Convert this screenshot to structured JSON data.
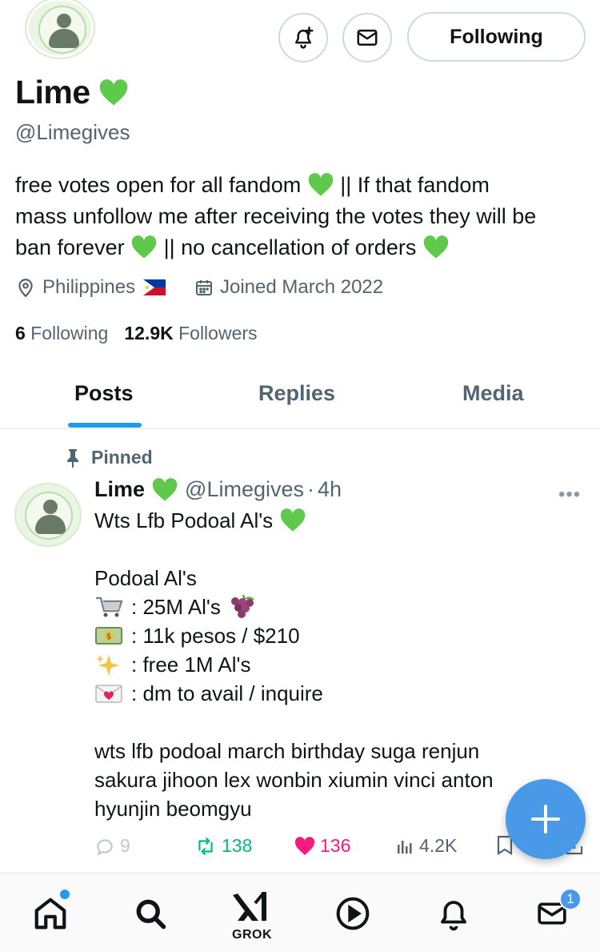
{
  "profile": {
    "name": "Lime",
    "handle": "@Limegives",
    "bio_line1": "free votes open for all fandom",
    "bio_line1b": "|| If that fandom",
    "bio_line2": "mass unfollow me after receiving the votes they will be",
    "bio_line3a": "ban forever",
    "bio_line3b": "|| no cancellation of orders",
    "location": "Philippines",
    "joined": "Joined March 2022",
    "following_count": "6",
    "following_label": "Following",
    "followers_count": "12.9K",
    "followers_label": "Followers"
  },
  "header": {
    "follow_button": "Following"
  },
  "tabs": [
    {
      "label": "Posts"
    },
    {
      "label": "Replies"
    },
    {
      "label": "Media"
    }
  ],
  "post": {
    "pinned_label": "Pinned",
    "author": "Lime",
    "handle": "@Limegives",
    "time": "4h",
    "more": "•••",
    "lines": [
      "Wts Lfb Podoal Al's",
      "",
      "Podoal Al's",
      ": 25M Al's",
      ": 11k pesos / $210",
      ": free 1M Al's",
      ": dm to avail / inquire",
      "",
      "wts lfb podoal march birthday suga renjun",
      "sakura jihoon lex wonbin xiumin vinci anton",
      "hyunjin beomgyu"
    ],
    "replies": "9",
    "reposts": "138",
    "likes": "136",
    "views": "4.2K"
  },
  "bottom_nav": {
    "grok_label": "GROK",
    "messages_badge": "1"
  },
  "colors": {
    "accent": "#1d9bf0",
    "fab": "#4a99e9",
    "repost": "#00ba7c",
    "like": "#f91880",
    "heart": "#5ec94a",
    "muted": "#536471"
  }
}
